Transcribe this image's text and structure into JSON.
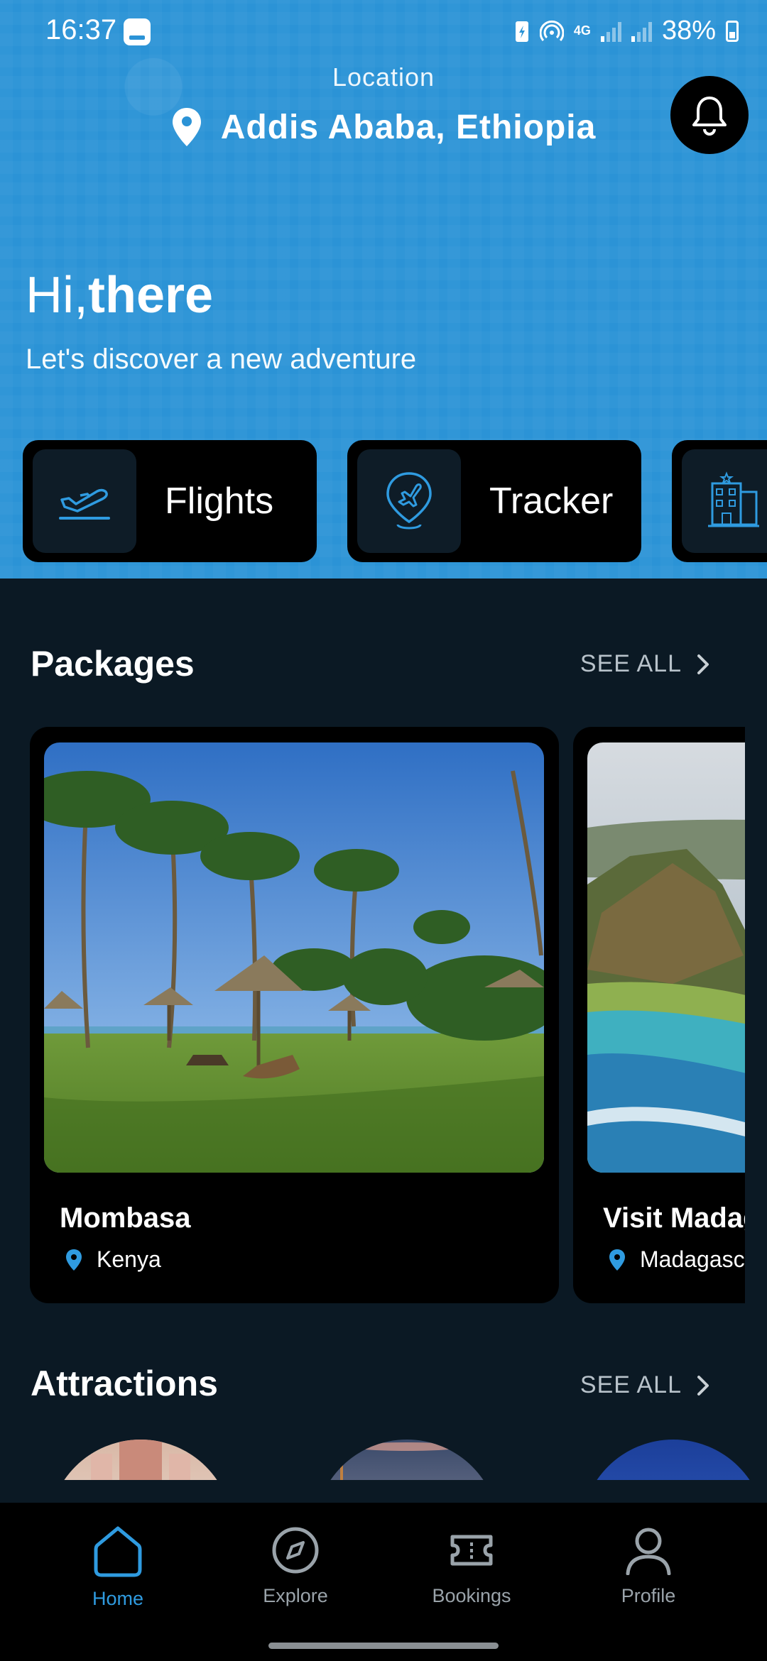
{
  "status_bar": {
    "time": "16:37",
    "battery": "38%",
    "network": "4G"
  },
  "header": {
    "location_label": "Location",
    "location_value": "Addis Ababa, Ethiopia",
    "greeting_hi": "Hi,",
    "greeting_name": "there",
    "subtitle": "Let's discover a new adventure"
  },
  "categories": [
    {
      "label": "Flights",
      "icon": "plane-takeoff-icon"
    },
    {
      "label": "Tracker",
      "icon": "plane-location-pin-icon"
    },
    {
      "label": "",
      "icon": "hotel-building-icon"
    }
  ],
  "packages": {
    "title": "Packages",
    "see_all": "SEE ALL",
    "items": [
      {
        "name": "Mombasa",
        "country": "Kenya"
      },
      {
        "name": "Visit Madagascar",
        "country": "Madagascar"
      }
    ]
  },
  "attractions": {
    "title": "Attractions",
    "see_all": "SEE ALL"
  },
  "bottom_nav": {
    "items": [
      {
        "label": "Home",
        "icon": "home-icon",
        "active": true
      },
      {
        "label": "Explore",
        "icon": "compass-icon",
        "active": false
      },
      {
        "label": "Bookings",
        "icon": "ticket-icon",
        "active": false
      },
      {
        "label": "Profile",
        "icon": "user-icon",
        "active": false
      }
    ]
  },
  "colors": {
    "hero_blue": "#2b93d6",
    "background": "#0b1924",
    "accent": "#2f9be0"
  }
}
